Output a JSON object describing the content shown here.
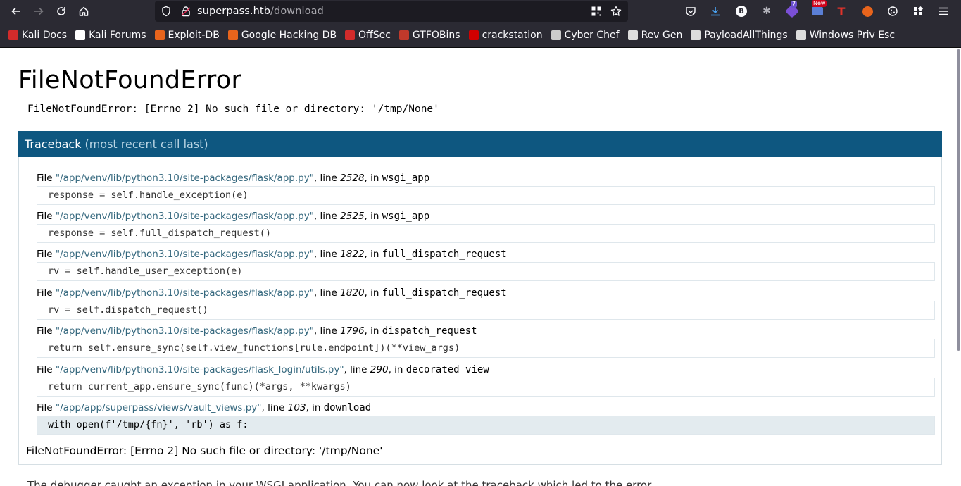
{
  "browser": {
    "url_host": "superpass.htb",
    "url_path": "/download",
    "extension_badges": {
      "badge_7": "7",
      "badge_new": "New"
    }
  },
  "bookmarks": [
    {
      "label": "Kali Docs",
      "icon": "kali-docs-icon",
      "color": "#d22b2b"
    },
    {
      "label": "Kali Forums",
      "icon": "kali-forums-icon",
      "color": "#ffffff"
    },
    {
      "label": "Exploit-DB",
      "icon": "exploit-db-icon",
      "color": "#e8641c"
    },
    {
      "label": "Google Hacking DB",
      "icon": "ghdb-icon",
      "color": "#e8641c"
    },
    {
      "label": "OffSec",
      "icon": "offsec-icon",
      "color": "#d22b2b"
    },
    {
      "label": "GTFOBins",
      "icon": "gtfobins-icon",
      "color": "#c0392b"
    },
    {
      "label": "crackstation",
      "icon": "crackstation-icon",
      "color": "#d10000"
    },
    {
      "label": "Cyber Chef",
      "icon": "cyberchef-icon",
      "color": "#cccccc"
    },
    {
      "label": "Rev Gen",
      "icon": "skull-icon",
      "color": "#dddddd"
    },
    {
      "label": "PayloadAllThings",
      "icon": "github-icon",
      "color": "#dddddd"
    },
    {
      "label": "Windows Priv Esc",
      "icon": "book-icon",
      "color": "#dddddd"
    }
  ],
  "error": {
    "title": "FileNotFoundError",
    "message": "FileNotFoundError: [Errno 2] No such file or directory: '/tmp/None'",
    "traceback_heading": "Traceback",
    "traceback_sub": "(most recent call last)",
    "final_message": "FileNotFoundError: [Errno 2] No such file or directory: '/tmp/None'",
    "explanation": "The debugger caught an exception in your WSGI application. You can now look at the traceback which led to the error."
  },
  "frames": [
    {
      "file": "\"/app/venv/lib/python3.10/site-packages/flask/app.py\"",
      "line": "2528",
      "func": "wsgi_app",
      "code": "response = self.handle_exception(e)"
    },
    {
      "file": "\"/app/venv/lib/python3.10/site-packages/flask/app.py\"",
      "line": "2525",
      "func": "wsgi_app",
      "code": "response = self.full_dispatch_request()"
    },
    {
      "file": "\"/app/venv/lib/python3.10/site-packages/flask/app.py\"",
      "line": "1822",
      "func": "full_dispatch_request",
      "code": "rv = self.handle_user_exception(e)"
    },
    {
      "file": "\"/app/venv/lib/python3.10/site-packages/flask/app.py\"",
      "line": "1820",
      "func": "full_dispatch_request",
      "code": "rv = self.dispatch_request()"
    },
    {
      "file": "\"/app/venv/lib/python3.10/site-packages/flask/app.py\"",
      "line": "1796",
      "func": "dispatch_request",
      "code": "return self.ensure_sync(self.view_functions[rule.endpoint])(**view_args)"
    },
    {
      "file": "\"/app/venv/lib/python3.10/site-packages/flask_login/utils.py\"",
      "line": "290",
      "func": "decorated_view",
      "code": "return current_app.ensure_sync(func)(*args, **kwargs)"
    },
    {
      "file": "\"/app/app/superpass/views/vault_views.py\"",
      "line": "103",
      "func": "download",
      "code": "with open(f'/tmp/{fn}', 'rb') as f:"
    }
  ],
  "labels": {
    "file_prefix": "File",
    "line_prefix": ", line",
    "in_prefix": ", in"
  }
}
